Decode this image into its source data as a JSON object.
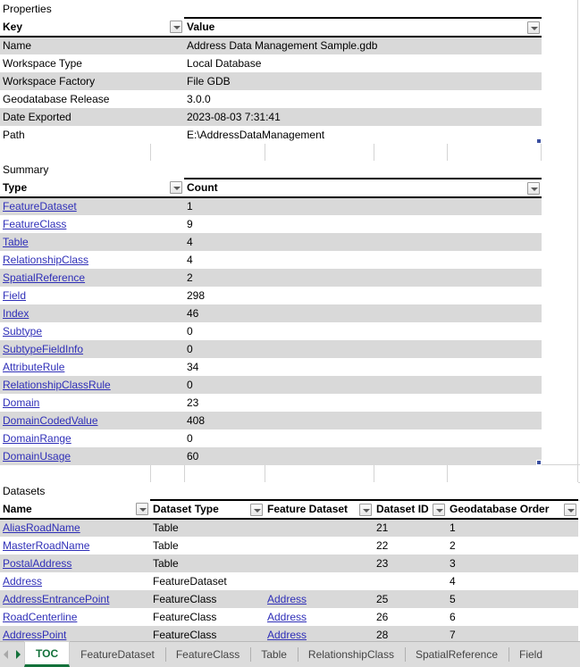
{
  "properties": {
    "section_title": "Properties",
    "columns": [
      "Key",
      "Value"
    ],
    "rows": [
      {
        "key": "Name",
        "value": "Address Data Management Sample.gdb",
        "align": "left"
      },
      {
        "key": "Workspace Type",
        "value": "Local Database",
        "align": "left"
      },
      {
        "key": "Workspace Factory",
        "value": "File GDB",
        "align": "left"
      },
      {
        "key": "Geodatabase Release",
        "value": "3.0.0",
        "align": "left"
      },
      {
        "key": "Date Exported",
        "value": "2023-08-03 7:31:41",
        "align": "right"
      },
      {
        "key": "Path",
        "value": "E:\\AddressDataManagement",
        "align": "left"
      }
    ]
  },
  "summary": {
    "section_title": "Summary",
    "columns": [
      "Type",
      "Count"
    ],
    "rows": [
      {
        "type": "FeatureDataset",
        "count": "1"
      },
      {
        "type": "FeatureClass",
        "count": "9"
      },
      {
        "type": "Table",
        "count": "4"
      },
      {
        "type": "RelationshipClass",
        "count": "4"
      },
      {
        "type": "SpatialReference",
        "count": "2"
      },
      {
        "type": "Field",
        "count": "298"
      },
      {
        "type": "Index",
        "count": "46"
      },
      {
        "type": "Subtype",
        "count": "0"
      },
      {
        "type": "SubtypeFieldInfo",
        "count": "0"
      },
      {
        "type": "AttributeRule",
        "count": "34"
      },
      {
        "type": "RelationshipClassRule",
        "count": "0"
      },
      {
        "type": "Domain",
        "count": "23"
      },
      {
        "type": "DomainCodedValue",
        "count": "408"
      },
      {
        "type": "DomainRange",
        "count": "0"
      },
      {
        "type": "DomainUsage",
        "count": "60"
      }
    ]
  },
  "datasets": {
    "section_title": "Datasets",
    "columns": [
      "Name",
      "Dataset Type",
      "Feature Dataset",
      "Dataset ID",
      "Geodatabase Order"
    ],
    "rows": [
      {
        "name": "AliasRoadName",
        "dataset_type": "Table",
        "feature_dataset": "",
        "dataset_id": "21",
        "order": "1"
      },
      {
        "name": "MasterRoadName",
        "dataset_type": "Table",
        "feature_dataset": "",
        "dataset_id": "22",
        "order": "2"
      },
      {
        "name": "PostalAddress",
        "dataset_type": "Table",
        "feature_dataset": "",
        "dataset_id": "23",
        "order": "3"
      },
      {
        "name": "Address",
        "dataset_type": "FeatureDataset",
        "feature_dataset": "",
        "dataset_id": "",
        "order": "4"
      },
      {
        "name": "AddressEntrancePoint",
        "dataset_type": "FeatureClass",
        "feature_dataset": "Address",
        "dataset_id": "25",
        "order": "5"
      },
      {
        "name": "RoadCenterline",
        "dataset_type": "FeatureClass",
        "feature_dataset": "Address",
        "dataset_id": "26",
        "order": "6"
      },
      {
        "name": "AddressPoint",
        "dataset_type": "FeatureClass",
        "feature_dataset": "Address",
        "dataset_id": "28",
        "order": "7"
      }
    ]
  },
  "sheet_tabs": {
    "tabs": [
      {
        "label": "TOC",
        "active": true
      },
      {
        "label": "FeatureDataset",
        "active": false
      },
      {
        "label": "FeatureClass",
        "active": false
      },
      {
        "label": "Table",
        "active": false
      },
      {
        "label": "RelationshipClass",
        "active": false
      },
      {
        "label": "SpatialReference",
        "active": false
      },
      {
        "label": "Field",
        "active": false
      }
    ]
  },
  "colors": {
    "link": "#2f2fb8",
    "band": "#d9d9d9",
    "active_tab": "#13713a",
    "grid": "#d4d4d4"
  }
}
